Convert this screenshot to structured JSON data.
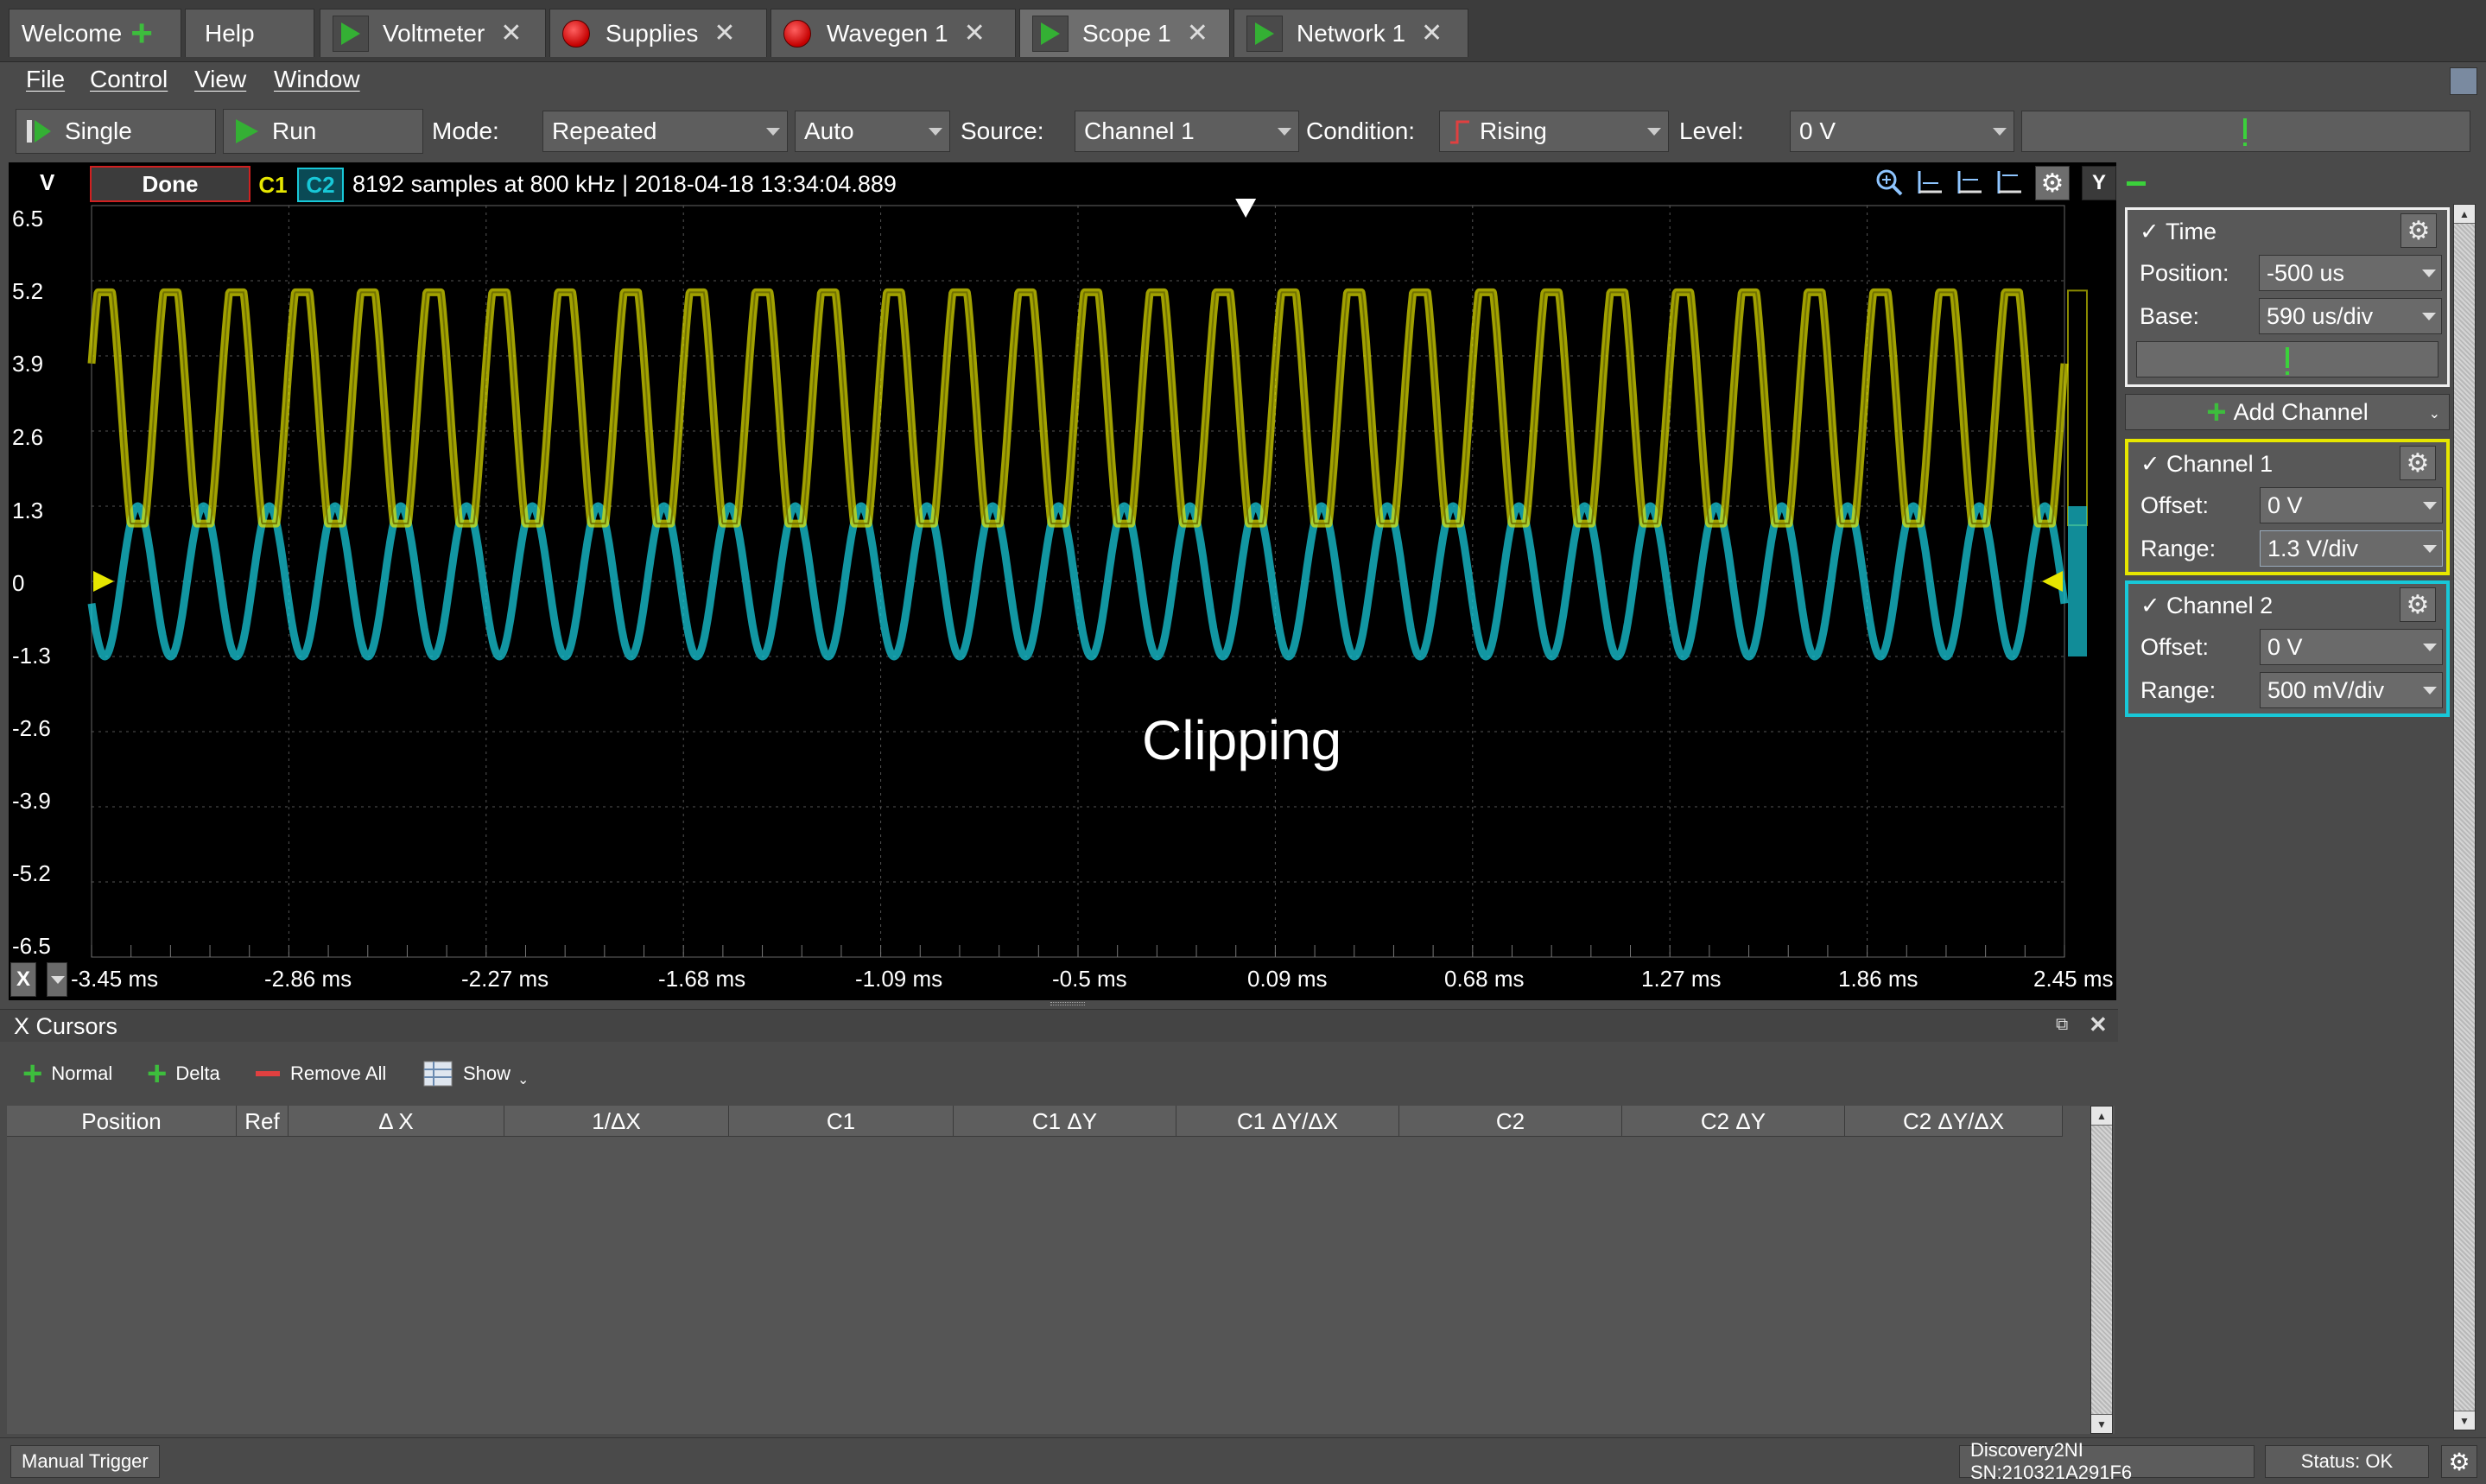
{
  "tabs": [
    {
      "label": "Welcome"
    },
    {
      "label": "Help"
    },
    {
      "label": "Voltmeter"
    },
    {
      "label": "Supplies"
    },
    {
      "label": "Wavegen 1"
    },
    {
      "label": "Scope 1"
    },
    {
      "label": "Network 1"
    }
  ],
  "menu": [
    "File",
    "Control",
    "View",
    "Window"
  ],
  "toolbar": {
    "single": "Single",
    "run": "Run",
    "mode_label": "Mode:",
    "mode_value": "Repeated",
    "trigger_mode": "Auto",
    "source_label": "Source:",
    "source_value": "Channel 1",
    "condition_label": "Condition:",
    "condition_value": "Rising",
    "level_label": "Level:",
    "level_value": "0 V"
  },
  "scope": {
    "unit": "V",
    "status": "Done",
    "ch1_tag": "C1",
    "ch2_tag": "C2",
    "info": "8192 samples at 800 kHz | 2018-04-18 13:34:04.889",
    "y_ticks": [
      "6.5",
      "5.2",
      "3.9",
      "2.6",
      "1.3",
      "0",
      "-1.3",
      "-2.6",
      "-3.9",
      "-5.2",
      "-6.5"
    ],
    "x_ticks": [
      "-3.45 ms",
      "-2.86 ms",
      "-2.27 ms",
      "-1.68 ms",
      "-1.09 ms",
      "-0.5 ms",
      "0.09 ms",
      "0.68 ms",
      "1.27 ms",
      "1.86 ms",
      "2.45 ms"
    ],
    "annotation": "Clipping",
    "y_btn": "Y",
    "x_btn": "X"
  },
  "cursors": {
    "title": "X Cursors",
    "normal": "Normal",
    "delta": "Delta",
    "remove_all": "Remove All",
    "show": "Show",
    "columns": [
      "Position",
      "Ref",
      "Δ X",
      "1/ΔX",
      "C1",
      "C1 ΔY",
      "C1 ΔY/ΔX",
      "C2",
      "C2 ΔY",
      "C2 ΔY/ΔX"
    ]
  },
  "time_panel": {
    "title": "Time",
    "position_label": "Position:",
    "position_value": "-500 us",
    "base_label": "Base:",
    "base_value": "590 us/div"
  },
  "add_channel": "Add Channel",
  "channel1": {
    "title": "Channel 1",
    "offset_label": "Offset:",
    "offset_value": "0 V",
    "range_label": "Range:",
    "range_value": "1.3 V/div",
    "color": "#e6e600"
  },
  "channel2": {
    "title": "Channel 2",
    "offset_label": "Offset:",
    "offset_value": "0 V",
    "range_label": "Range:",
    "range_value": "500 mV/div",
    "color": "#18c8d8"
  },
  "status": {
    "manual_trigger": "Manual Trigger",
    "device": "Discovery2NI SN:210321A291F6",
    "status": "Status: OK"
  }
}
